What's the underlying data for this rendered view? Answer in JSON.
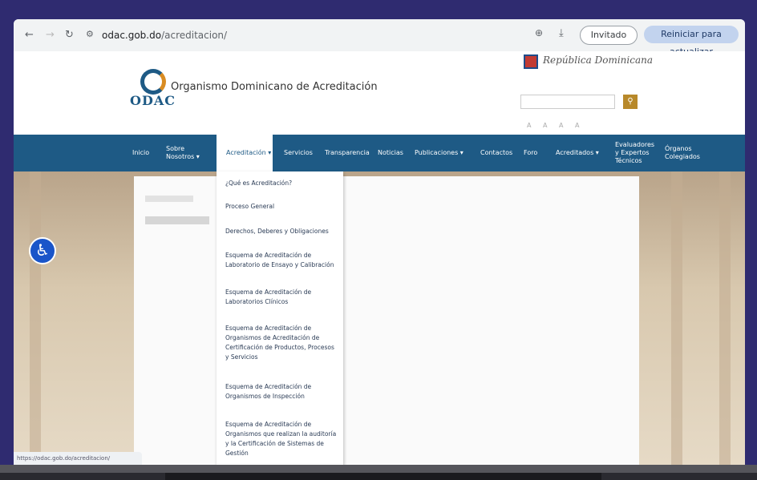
{
  "browser": {
    "url_domain": "odac.gob.do",
    "url_path": "/acreditacion/",
    "incognito_label": "Invitado",
    "update_label": "Reiniciar para actualizar"
  },
  "header": {
    "logo_text": "ODAC",
    "org_title": "Organismo Dominicano de Acreditación",
    "republic_text": "República Dominicana"
  },
  "nav": {
    "items": [
      {
        "label": "Inicio"
      },
      {
        "label": "Sobre Nosotros ▾"
      },
      {
        "label": "Acreditación ▾"
      },
      {
        "label": "Servicios"
      },
      {
        "label": "Transparencia"
      },
      {
        "label": "Noticias"
      },
      {
        "label": "Publicaciones ▾"
      },
      {
        "label": "Contactos"
      },
      {
        "label": "Foro"
      },
      {
        "label": "Acreditados ▾"
      },
      {
        "label": "Evaluadores y Expertos Técnicos"
      },
      {
        "label": "Órganos Colegiados"
      }
    ]
  },
  "dropdown": {
    "items": [
      {
        "label": "¿Qué es Acreditación?"
      },
      {
        "label": "Proceso General"
      },
      {
        "label": "Derechos, Deberes y Obligaciones"
      },
      {
        "label": "Esquema de Acreditación de Laboratorio de Ensayo y Calibración"
      },
      {
        "label": "Esquema de Acreditación de Laboratorios Clínicos"
      },
      {
        "label": "Esquema de Acreditación de Organismos de Acreditación de Certificación de Productos, Procesos y Servicios"
      },
      {
        "label": "Esquema de Acreditación de Organismos de Inspección"
      },
      {
        "label": "Esquema de Acreditación de Organismos que realizan la auditoría y la Certificación de Sistemas de Gestión"
      }
    ]
  },
  "status_bar": {
    "text": "https://odac.gob.do/acreditacion/"
  },
  "icons": {
    "back": "back-arrow-icon",
    "forward": "forward-arrow-icon",
    "reload": "reload-icon",
    "site_info": "tune-icon",
    "zoom": "zoom-icon",
    "download": "download-icon",
    "search": "search-icon",
    "accessibility": "accessibility-icon"
  },
  "colors": {
    "nav_bg": "#1e5a85",
    "search_btn": "#b8892a",
    "a11y": "#1a55c9",
    "frame": "#2f2b70"
  }
}
